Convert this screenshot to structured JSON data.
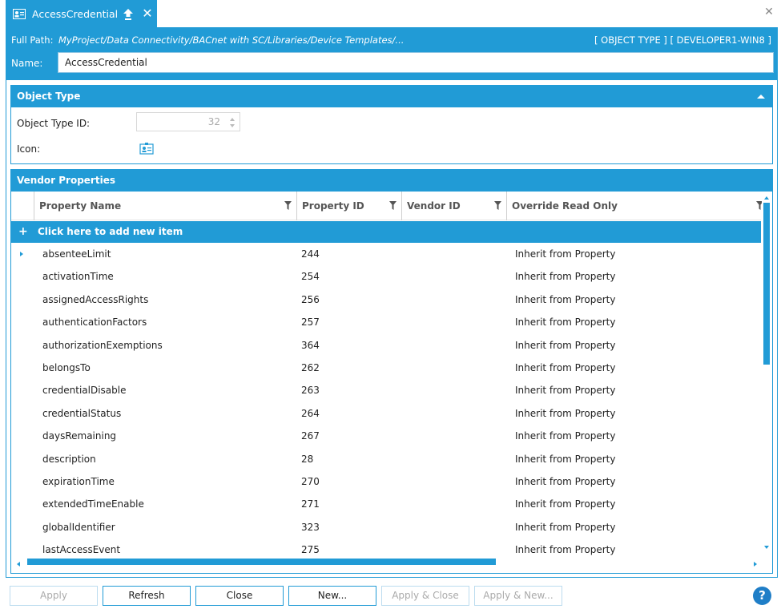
{
  "tab": {
    "title": "AccessCredential",
    "close_glyph": "✕"
  },
  "window": {
    "close_glyph": "✕"
  },
  "header": {
    "full_path_label": "Full Path:",
    "full_path_value": "MyProject/Data Connectivity/BACnet with SC/Libraries/Device Templates/...",
    "type_badge": "[ OBJECT TYPE ] [ DEVELOPER1-WIN8 ]",
    "name_label": "Name:",
    "name_value": "AccessCredential"
  },
  "object_type": {
    "title": "Object Type",
    "id_label": "Object Type ID:",
    "id_value": "32",
    "icon_label": "Icon:"
  },
  "vendor": {
    "title": "Vendor Properties",
    "columns": [
      "Property Name",
      "Property ID",
      "Vendor ID",
      "Override Read Only"
    ],
    "add_label": "Click here to add new item",
    "add_glyph": "+",
    "rows": [
      {
        "name": "absenteeLimit",
        "id": "244",
        "vendor": "",
        "override": "Inherit from Property"
      },
      {
        "name": "activationTime",
        "id": "254",
        "vendor": "",
        "override": "Inherit from Property"
      },
      {
        "name": "assignedAccessRights",
        "id": "256",
        "vendor": "",
        "override": "Inherit from Property"
      },
      {
        "name": "authenticationFactors",
        "id": "257",
        "vendor": "",
        "override": "Inherit from Property"
      },
      {
        "name": "authorizationExemptions",
        "id": "364",
        "vendor": "",
        "override": "Inherit from Property"
      },
      {
        "name": "belongsTo",
        "id": "262",
        "vendor": "",
        "override": "Inherit from Property"
      },
      {
        "name": "credentialDisable",
        "id": "263",
        "vendor": "",
        "override": "Inherit from Property"
      },
      {
        "name": "credentialStatus",
        "id": "264",
        "vendor": "",
        "override": "Inherit from Property"
      },
      {
        "name": "daysRemaining",
        "id": "267",
        "vendor": "",
        "override": "Inherit from Property"
      },
      {
        "name": "description",
        "id": "28",
        "vendor": "",
        "override": "Inherit from Property"
      },
      {
        "name": "expirationTime",
        "id": "270",
        "vendor": "",
        "override": "Inherit from Property"
      },
      {
        "name": "extendedTimeEnable",
        "id": "271",
        "vendor": "",
        "override": "Inherit from Property"
      },
      {
        "name": "globalIdentifier",
        "id": "323",
        "vendor": "",
        "override": "Inherit from Property"
      },
      {
        "name": "lastAccessEvent",
        "id": "275",
        "vendor": "",
        "override": "Inherit from Property"
      }
    ]
  },
  "buttons": {
    "apply": "Apply",
    "refresh": "Refresh",
    "close": "Close",
    "new": "New...",
    "apply_close": "Apply & Close",
    "apply_new": "Apply & New..."
  },
  "help_glyph": "?",
  "colors": {
    "accent": "#219bd6",
    "help": "#1f7ec7",
    "disabled_text": "#aaaaaa"
  },
  "icons": {
    "tab": "id-card-icon",
    "pin": "pin-up-arrow-icon",
    "filter": "filter-funnel-icon",
    "row_indicator": "current-row-triangle-icon"
  }
}
